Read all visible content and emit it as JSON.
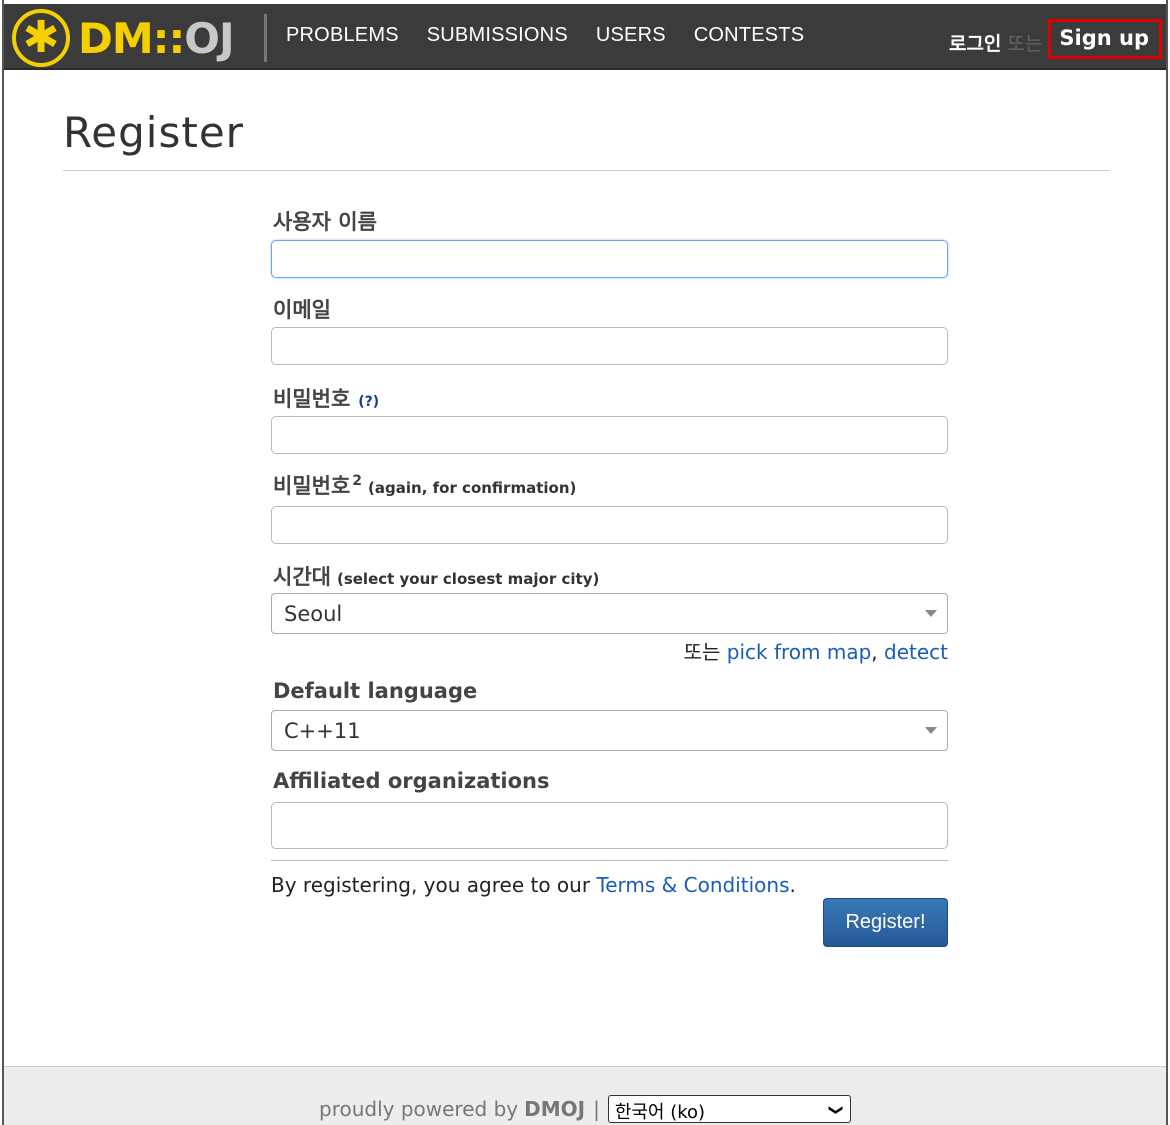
{
  "nav": {
    "logo_left": "DM",
    "logo_sep": "::",
    "logo_right": "OJ",
    "items": [
      {
        "label": "PROBLEMS"
      },
      {
        "label": "SUBMISSIONS"
      },
      {
        "label": "USERS"
      },
      {
        "label": "CONTESTS"
      }
    ],
    "login": "로그인",
    "or": "또는",
    "signup": "Sign up"
  },
  "page": {
    "title": "Register"
  },
  "form": {
    "username": {
      "label": "사용자 이름",
      "value": ""
    },
    "email": {
      "label": "이메일",
      "value": ""
    },
    "password": {
      "label": "비밀번호",
      "help": "(?)",
      "value": ""
    },
    "password2": {
      "label": "비밀번호",
      "sup": "2",
      "hint": "(again, for confirmation)",
      "value": ""
    },
    "timezone": {
      "label": "시간대",
      "hint": "(select your closest major city)",
      "value": "Seoul",
      "or": "또는",
      "pick_link": "pick from map",
      "comma": ",",
      "detect_link": "detect"
    },
    "language": {
      "label": "Default language",
      "value": "C++11"
    },
    "organizations": {
      "label": "Affiliated organizations",
      "value": ""
    },
    "terms": {
      "prefix": "By registering, you agree to our",
      "link": "Terms & Conditions",
      "suffix": "."
    },
    "submit": "Register!"
  },
  "footer": {
    "powered": "proudly powered by",
    "brand": "DMOJ",
    "pipe": "|",
    "language_select": "한국어 (ko)"
  }
}
